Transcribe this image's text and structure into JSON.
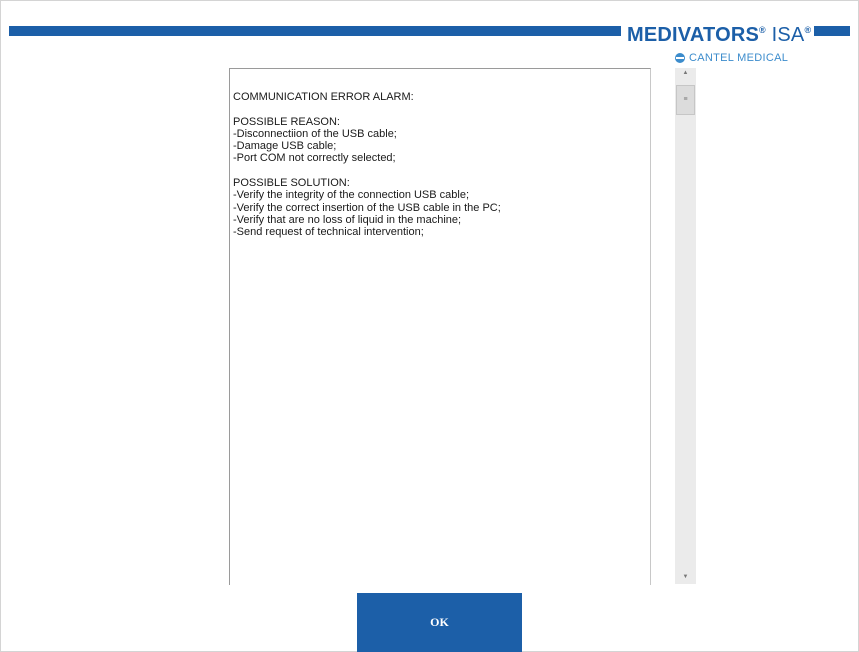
{
  "header": {
    "brand_name": "MEDIVATORS",
    "brand_reg": "®",
    "brand_suffix": "ISA",
    "brand_suffix_reg": "®",
    "sub_brand": "CANTEL MEDICAL",
    "sub_brand_icon": "globe-icon",
    "brand_color": "#1c5fa8"
  },
  "dialog": {
    "message": "COMMUNICATION ERROR ALARM:\n\nPOSSIBLE REASON:\n-Disconnectiion of the USB cable;\n-Damage USB cable;\n-Port COM not correctly selected;\n\nPOSSIBLE SOLUTION:\n-Verify the integrity of the connection USB cable;\n-Verify the correct insertion of the USB cable in the PC;\n-Verify that are no loss of liquid in the machine;\n-Send request of technical intervention;",
    "ok_label": "OK"
  },
  "scrollbar": {
    "up_icon": "arrow-up-icon",
    "down_icon": "arrow-down-icon",
    "thumb_icon": "grip-icon"
  }
}
